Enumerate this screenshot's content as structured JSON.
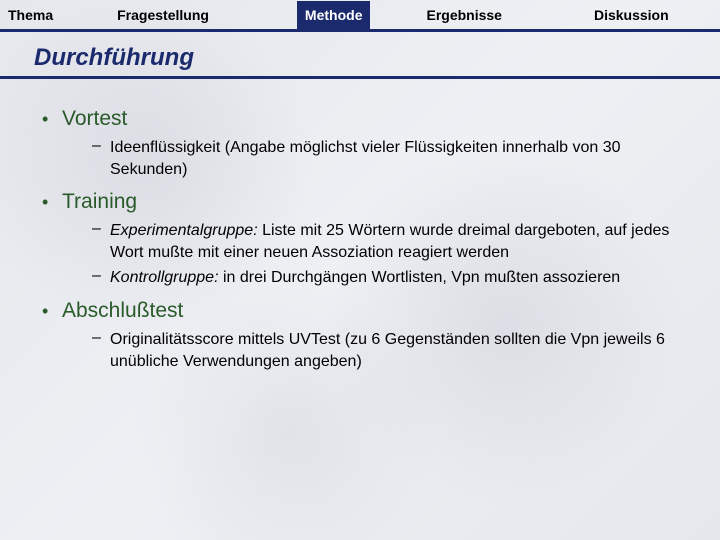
{
  "nav": {
    "items": [
      {
        "label": "Thema",
        "active": false
      },
      {
        "label": "Fragestellung",
        "active": false
      },
      {
        "label": "Methode",
        "active": true
      },
      {
        "label": "Ergebnisse",
        "active": false
      },
      {
        "label": "Diskussion",
        "active": false
      }
    ]
  },
  "section_title": "Durchführung",
  "content": {
    "vortest": {
      "label": "Vortest",
      "sub": [
        {
          "prefix": "",
          "text": "Ideenflüssigkeit (Angabe möglichst vieler Flüssigkeiten innerhalb von 30 Sekunden)"
        }
      ]
    },
    "training": {
      "label": "Training",
      "sub": [
        {
          "prefix": "Experimentalgruppe:",
          "text": "  Liste mit 25 Wörtern wurde dreimal dargeboten, auf jedes Wort mußte mit einer neuen Assoziation reagiert werden"
        },
        {
          "prefix": "Kontrollgruppe:",
          "text": "  in drei Durchgängen Wortlisten,  Vpn mußten assozieren"
        }
      ]
    },
    "abschlusstest": {
      "label": "Abschlußtest",
      "sub": [
        {
          "prefix": "",
          "text": "Originalitätsscore mittels UVTest (zu 6 Gegenständen sollten die Vpn jeweils 6  unübliche Verwendungen angeben)"
        }
      ]
    }
  }
}
